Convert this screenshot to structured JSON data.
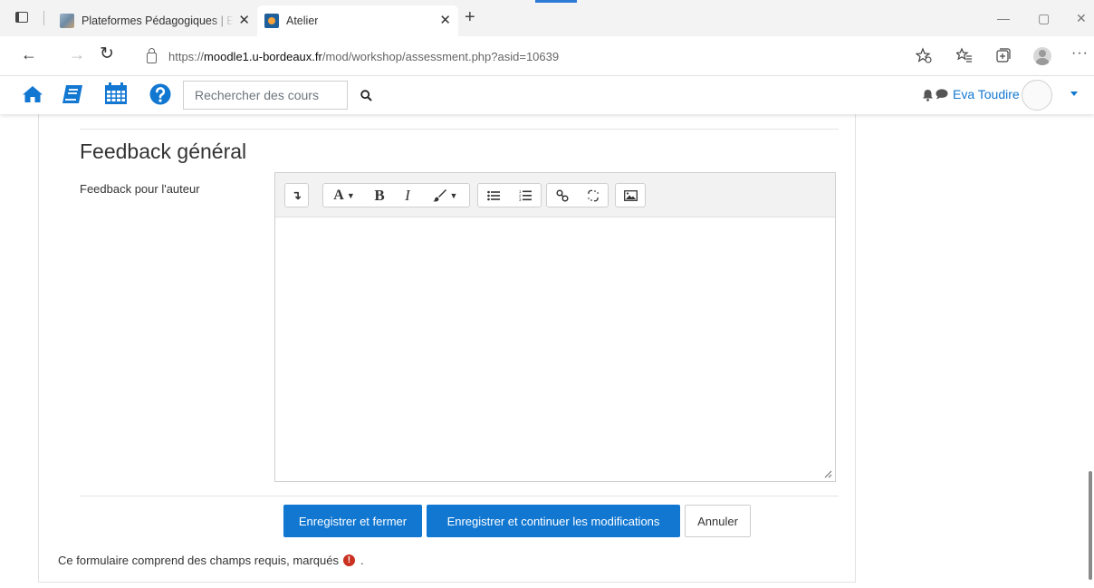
{
  "browser": {
    "tabs": [
      {
        "title": "Plateformes Pédagogiques | ENT",
        "close": "✕"
      },
      {
        "title": "Atelier",
        "close": "✕"
      }
    ],
    "new_tab": "+",
    "url_scheme": "https://",
    "url_host": "moodle1.u-bordeaux.fr",
    "url_path": "/mod/workshop/assessment.php?asid=10639",
    "window_controls": {
      "minimize": "—",
      "maximize": "▢",
      "close": "✕"
    },
    "nav": {
      "back": "←",
      "forward": "→",
      "reload": "↻"
    },
    "menu": "···",
    "accent": "#2e7bd6"
  },
  "navbar": {
    "search_placeholder": "Rechercher des cours",
    "user_name": "Eva Toudire",
    "icons": [
      "home-icon",
      "book-icon",
      "calendar-icon",
      "help-icon",
      "search-icon",
      "bell-icon",
      "chat-icon",
      "avatar"
    ],
    "brand_color": "#1177d1"
  },
  "form": {
    "section_title": "Feedback général",
    "field_label": "Feedback pour l'auteur",
    "editor_value": "",
    "toolbar": {
      "bold": "B",
      "italic": "I",
      "font": "A",
      "collapse": "↴"
    },
    "buttons": {
      "save_close": "Enregistrer et fermer",
      "save_continue": "Enregistrer et continuer les modifications",
      "cancel": "Annuler"
    },
    "required_note": "Ce formulaire comprend des champs requis, marqués",
    "required_note_end": ".",
    "required_mark": "!",
    "required_color": "#ca3120"
  }
}
